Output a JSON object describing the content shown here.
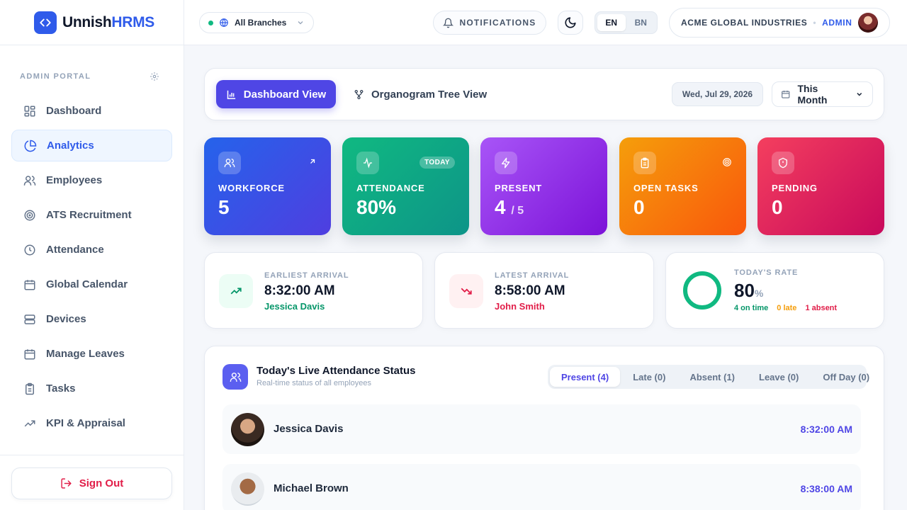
{
  "brand": {
    "name_prefix": "Unnish",
    "name_suffix": "HRMS"
  },
  "header": {
    "branch": "All Branches",
    "notifications": "NOTIFICATIONS",
    "languages": [
      "EN",
      "BN"
    ],
    "active_language": "EN",
    "organization": "ACME GLOBAL INDUSTRIES",
    "separator": "•",
    "role": "ADMIN"
  },
  "sidebar": {
    "portal_label": "ADMIN PORTAL",
    "items": [
      {
        "label": "Dashboard",
        "icon": "grid-icon"
      },
      {
        "label": "Analytics",
        "icon": "pie-chart-icon",
        "active": true
      },
      {
        "label": "Employees",
        "icon": "users-icon"
      },
      {
        "label": "ATS Recruitment",
        "icon": "target-icon"
      },
      {
        "label": "Attendance",
        "icon": "clock-icon"
      },
      {
        "label": "Global Calendar",
        "icon": "calendar-icon"
      },
      {
        "label": "Devices",
        "icon": "server-icon"
      },
      {
        "label": "Manage Leaves",
        "icon": "calendar-days-icon"
      },
      {
        "label": "Tasks",
        "icon": "clipboard-icon"
      },
      {
        "label": "KPI & Appraisal",
        "icon": "trending-up-icon"
      }
    ],
    "sign_out": "Sign Out"
  },
  "views": {
    "dashboard": "Dashboard View",
    "organogram": "Organogram Tree View",
    "date": "Wed, Jul 29, 2026",
    "period": "This Month"
  },
  "stats": {
    "workforce": {
      "label": "WORKFORCE",
      "value": "5"
    },
    "attendance": {
      "label": "ATTENDANCE",
      "value": "80%",
      "badge": "TODAY"
    },
    "present": {
      "label": "PRESENT",
      "value": "4",
      "sub": "/ 5"
    },
    "open_tasks": {
      "label": "OPEN TASKS",
      "value": "0"
    },
    "pending": {
      "label": "PENDING",
      "value": "0"
    }
  },
  "arrivals": {
    "earliest": {
      "caption": "EARLIEST ARRIVAL",
      "time": "8:32:00 AM",
      "name": "Jessica Davis"
    },
    "latest": {
      "caption": "LATEST ARRIVAL",
      "time": "8:58:00 AM",
      "name": "John Smith"
    }
  },
  "rate": {
    "caption": "TODAY'S RATE",
    "value": "80",
    "unit": "%",
    "on_time": "4 on time",
    "late": "0 late",
    "absent": "1 absent"
  },
  "live": {
    "title": "Today's Live Attendance Status",
    "subtitle": "Real-time status of all employees",
    "tabs": [
      "Present (4)",
      "Late (0)",
      "Absent (1)",
      "Leave (0)",
      "Off Day (0)"
    ],
    "active_tab": "Present (4)",
    "rows": [
      {
        "name": "Jessica Davis",
        "time": "8:32:00 AM"
      },
      {
        "name": "Michael Brown",
        "time": "8:38:00 AM"
      }
    ]
  },
  "colors": {
    "primary": "#2f5bea",
    "indigo": "#4f46e5",
    "success": "#10b981",
    "danger": "#e11d48",
    "warning": "#f59e0b"
  }
}
